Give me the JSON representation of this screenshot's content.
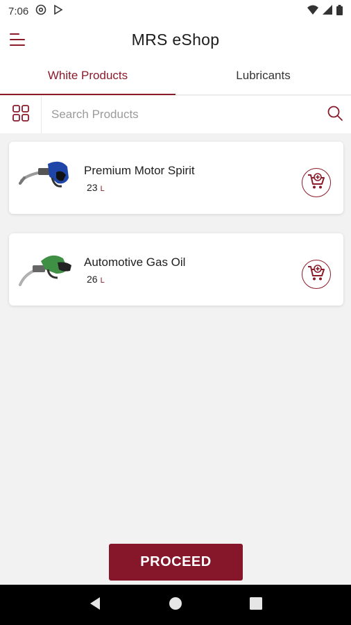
{
  "status_bar": {
    "time": "7:06"
  },
  "app_bar": {
    "title": "MRS eShop"
  },
  "tabs": [
    {
      "label": "White Products",
      "active": true
    },
    {
      "label": "Lubricants",
      "active": false
    }
  ],
  "search": {
    "placeholder": "Search Products",
    "value": ""
  },
  "products": [
    {
      "name": "Premium Motor Spirit",
      "quantity": "23",
      "unit": "L",
      "nozzle_color": "#1f45a8"
    },
    {
      "name": "Automotive Gas Oil",
      "quantity": "26",
      "unit": "L",
      "nozzle_color": "#3f8f45"
    }
  ],
  "proceed_label": "PROCEED",
  "colors": {
    "accent": "#8b1a2b",
    "background": "#f2f2f2"
  }
}
